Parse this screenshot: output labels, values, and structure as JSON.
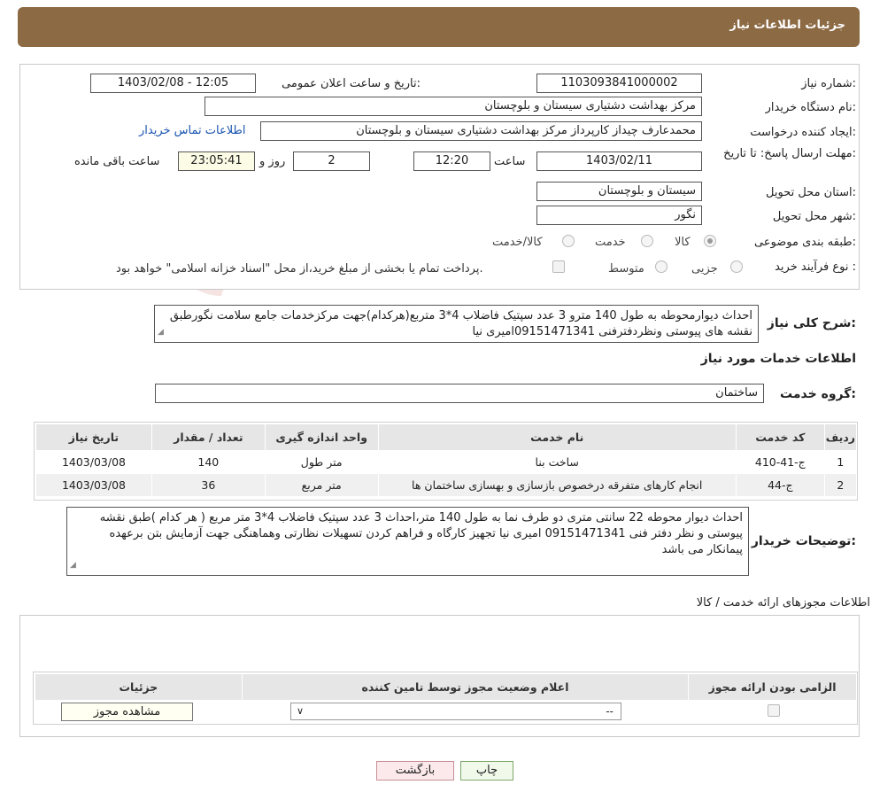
{
  "header": {
    "title": "جزئیات اطلاعات نیاز"
  },
  "labels": {
    "need_number": "شماره نیاز:",
    "announce_datetime": "تاریخ و ساعت اعلان عمومی:",
    "buyer_org": "نام دستگاه خریدار:",
    "requester": "ایجاد کننده درخواست:",
    "buyer_contact": "اطلاعات تماس خریدار",
    "deadline": "مهلت ارسال پاسخ: تا تاریخ:",
    "time_word": "ساعت",
    "day_word": "روز و",
    "remaining": "ساعت باقی مانده",
    "province": "استان محل تحویل:",
    "city": "شهر محل تحویل:",
    "category": "طبقه بندی موضوعی:",
    "purchase_type": "نوع فرآیند خرید :",
    "general_desc": "شرح کلی نیاز:",
    "services_info": "اطلاعات خدمات مورد نیاز",
    "service_group": "گروه خدمت:",
    "buyer_notes": "توضیحات خریدار:",
    "licenses_info": "اطلاعات مجوزهای ارائه خدمت / کالا"
  },
  "values": {
    "need_number": "1103093841000002",
    "announce_datetime": "1403/02/08 - 12:05",
    "buyer_org": "مرکز بهداشت دشتیاری سیستان و بلوچستان",
    "requester": "محمدعارف چیداز کارپرداز مرکز بهداشت دشتیاری سیستان و بلوچستان",
    "deadline_date": "1403/02/11",
    "deadline_time": "12:20",
    "days": "2",
    "remaining_time": "23:05:41",
    "province": "سیستان و بلوچستان",
    "city": "نگور",
    "service_group": "ساختمان"
  },
  "category_options": [
    {
      "label": "کالا",
      "checked": true
    },
    {
      "label": "خدمت",
      "checked": false
    },
    {
      "label": "کالا/خدمت",
      "checked": false
    }
  ],
  "purchase_options": [
    {
      "label": "جزیی"
    },
    {
      "label": "متوسط"
    }
  ],
  "treasury_note": "پرداخت تمام یا بخشی از مبلغ خرید،از محل \"اسناد خزانه اسلامی\" خواهد بود.",
  "general_desc": "احداث دیوارمحوطه به طول 140 مترو 3 عدد سپتیک فاضلاب 4*3 متربع(هرکدام)جهت مرکزخدمات جامع سلامت نگورطبق نقشه های پیوستی ونظردفترفنی 09151471341امیری نیا",
  "services_table": {
    "headers": [
      "ردیف",
      "کد خدمت",
      "نام خدمت",
      "واحد اندازه گیری",
      "تعداد / مقدار",
      "تاریخ نیاز"
    ],
    "rows": [
      [
        "1",
        "ج-41-410",
        "ساخت بنا",
        "متر طول",
        "140",
        "1403/03/08"
      ],
      [
        "2",
        "ج-44",
        "انجام کارهای متفرقه درخصوص بازسازی و بهسازی ساختمان ها",
        "متر مربع",
        "36",
        "1403/03/08"
      ]
    ]
  },
  "buyer_notes": "احداث دیوار محوطه 22 سانتی متری دو طرف نما به طول 140 متر،احداث  3 عدد سپتیک فاضلاب  4*3 متر مربع ( هر کدام )طبق نقشه پیوستی و نظر دفتر فنی 09151471341 امیری نیا تجهیز کارگاه و فراهم کردن تسهیلات نظارتی وهماهنگی جهت آزمایش بتن برعهده پیمانکار می باشد",
  "license_table": {
    "headers": [
      "الزامی بودن ارائه مجوز",
      "اعلام وضعیت مجوز توسط تامین کننده",
      "جزئیات"
    ],
    "select_value": "--",
    "view_button": "مشاهده مجوز"
  },
  "buttons": {
    "print": "چاپ",
    "back": "بازگشت"
  },
  "watermark": "AriaTender.neT"
}
